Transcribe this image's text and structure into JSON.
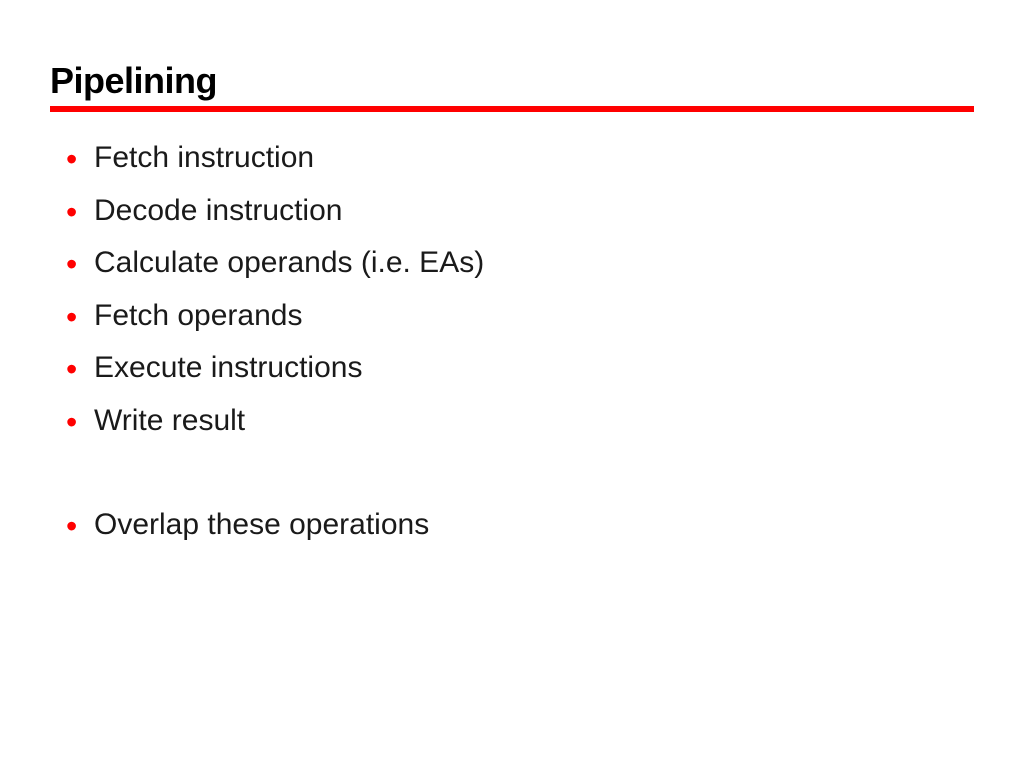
{
  "slide": {
    "title": "Pipelining",
    "bullets_group1": [
      "Fetch instruction",
      "Decode instruction",
      "Calculate operands (i.e. EAs)",
      "Fetch operands",
      "Execute instructions",
      "Write result"
    ],
    "bullets_group2": [
      "Overlap these operations"
    ]
  }
}
